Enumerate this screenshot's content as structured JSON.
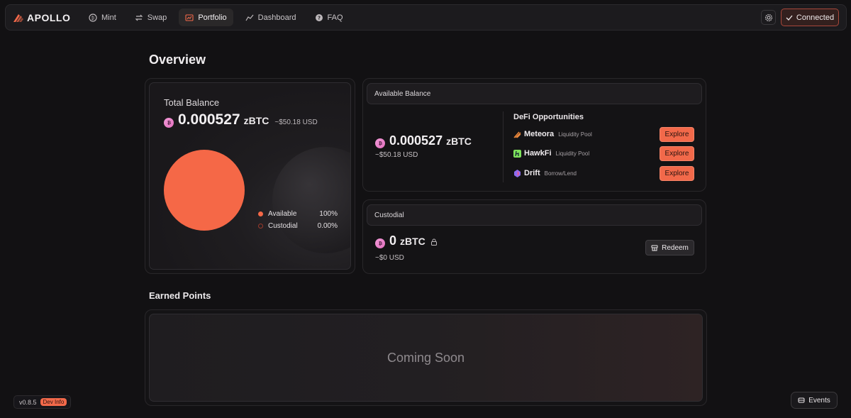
{
  "app": {
    "brand": "APOLLO"
  },
  "nav": {
    "items": [
      {
        "label": "Mint",
        "icon": "bitcoin-circle-icon"
      },
      {
        "label": "Swap",
        "icon": "swap-arrows-icon"
      },
      {
        "label": "Portfolio",
        "icon": "chart-icon",
        "active": true
      },
      {
        "label": "Dashboard",
        "icon": "dashboard-icon"
      },
      {
        "label": "FAQ",
        "icon": "question-icon"
      }
    ],
    "connected_label": "Connected"
  },
  "overview": {
    "title": "Overview",
    "total_balance": {
      "label": "Total Balance",
      "amount": "0.000527",
      "unit": "zBTC",
      "usd": "~$50.18 USD",
      "legend": [
        {
          "name": "Available",
          "value": "100%",
          "color": "#f56847"
        },
        {
          "name": "Custodial",
          "value": "0.00%",
          "color": "#7a2f23"
        }
      ]
    },
    "available_balance": {
      "header": "Available Balance",
      "amount": "0.000527",
      "unit": "zBTC",
      "usd": "~$50.18 USD",
      "defi_title": "DeFi Opportunities",
      "opportunities": [
        {
          "name": "Meteora",
          "type": "Liquidity Pool",
          "button": "Explore"
        },
        {
          "name": "HawkFi",
          "type": "Liquidity Pool",
          "button": "Explore"
        },
        {
          "name": "Drift",
          "type": "Borrow/Lend",
          "button": "Explore"
        }
      ]
    },
    "custodial": {
      "header": "Custodial",
      "amount": "0",
      "unit": "zBTC",
      "usd": "~$0 USD",
      "redeem_label": "Redeem"
    }
  },
  "earned_points": {
    "title": "Earned Points",
    "placeholder": "Coming Soon"
  },
  "footer": {
    "version": "v0.8.5",
    "dev_badge": "Dev Info",
    "events_label": "Events"
  },
  "colors": {
    "accent": "#f2694a",
    "background": "#121113",
    "card": "#1c1b1e"
  }
}
